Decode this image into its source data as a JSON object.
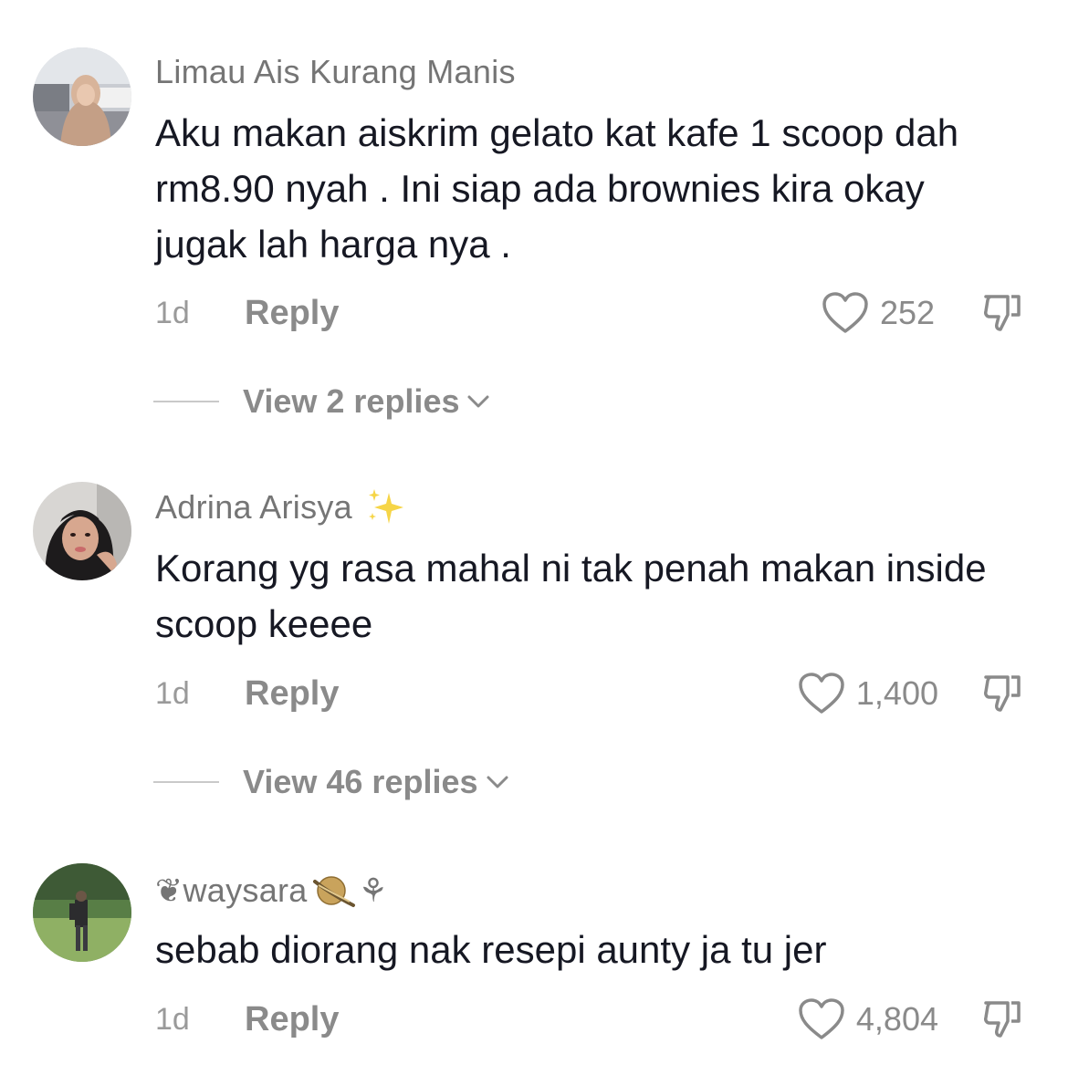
{
  "comments": [
    {
      "username": "Limau Ais Kurang Manis",
      "text": "Aku makan aiskrim gelato kat kafe 1 scoop dah rm8.90 nyah . Ini siap ada brownies kira okay jugak lah harga nya .",
      "time": "1d",
      "reply_label": "Reply",
      "likes": "252",
      "view_replies": "View 2 replies"
    },
    {
      "username": "Adrina Arisya",
      "username_emoji": "sparkles-icon",
      "text": "Korang yg rasa mahal ni tak penah makan inside scoop keeee",
      "time": "1d",
      "reply_label": "Reply",
      "likes": "1,400",
      "view_replies": "View 46 replies"
    },
    {
      "username_prefix": "❦",
      "username": "waysara",
      "username_emoji": "planet-icon",
      "username_suffix": "⚘",
      "text": "sebab diorang nak resepi aunty ja tu jer",
      "time": "1d",
      "reply_label": "Reply",
      "likes": "4,804"
    }
  ],
  "colors": {
    "username": "#757575",
    "text": "#161823",
    "muted": "#8a8a8a",
    "background": "#ffffff"
  }
}
